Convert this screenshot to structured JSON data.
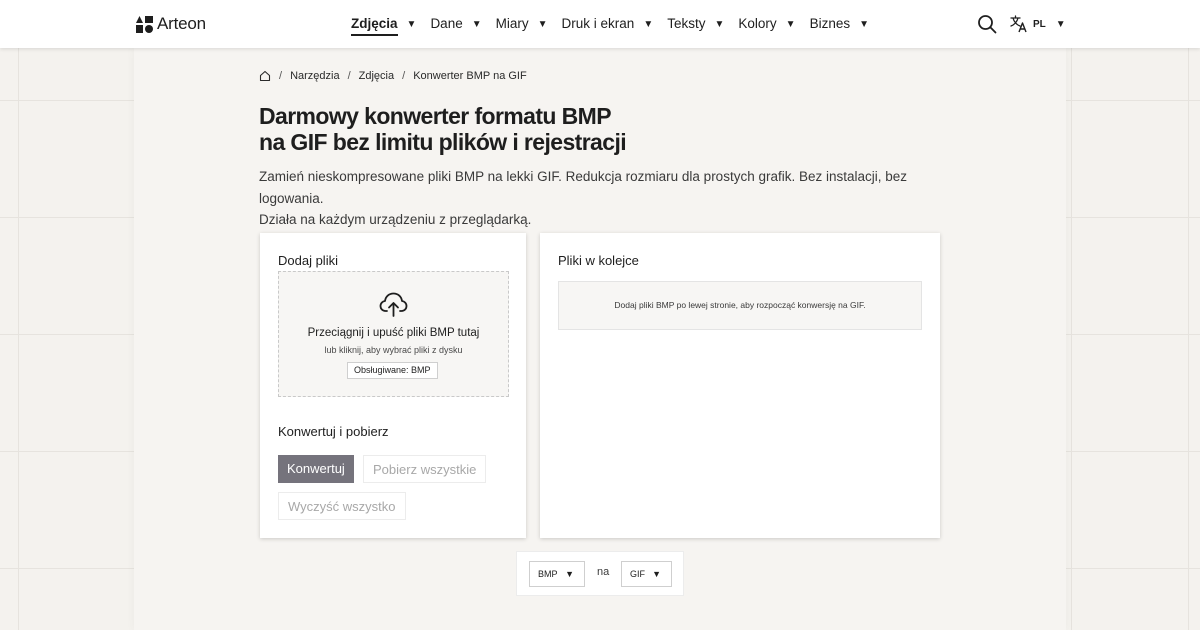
{
  "header": {
    "logo_text": "Arteon",
    "nav": [
      {
        "label": "Zdjęcia",
        "caret": "▼"
      },
      {
        "label": "Dane",
        "caret": "▼"
      },
      {
        "label": "Miary",
        "caret": "▼"
      },
      {
        "label": "Druk i ekran",
        "caret": "▼"
      },
      {
        "label": "Teksty",
        "caret": "▼"
      },
      {
        "label": "Kolory",
        "caret": "▼"
      },
      {
        "label": "Biznes",
        "caret": "▼"
      }
    ],
    "active_nav": "Zdjęcia",
    "search_icon": "search-icon",
    "language": {
      "icon": "translate-icon",
      "code": "PL",
      "caret": "▼"
    }
  },
  "breadcrumb": {
    "home_icon": "home-icon",
    "items": [
      "Narzędzia",
      "Zdjęcia",
      "Konwerter BMP na GIF"
    ],
    "separator": "/"
  },
  "page": {
    "title_line1": "Darmowy konwerter formatu BMP",
    "title_line2": "na GIF bez limitu plików i rejestracji",
    "subtitle_line1": "Zamień nieskompresowane pliki BMP na lekki GIF. Redukcja rozmiaru dla prostych grafik. Bez instalacji, bez logowania.",
    "subtitle_line2": "Działa na każdym urządzeniu z przeglądarką."
  },
  "upload": {
    "heading": "Dodaj pliki",
    "icon": "cloud-upload-icon",
    "drop_main": "Przeciągnij i upuść pliki BMP tutaj",
    "drop_sub": "lub kliknij, aby wybrać pliki z dysku",
    "supported": "Obsługiwane: BMP"
  },
  "actions": {
    "heading": "Konwertuj i pobierz",
    "convert": "Konwertuj",
    "download_all": "Pobierz wszystkie",
    "clear_all": "Wyczyść wszystko"
  },
  "queue": {
    "heading": "Pliki w kolejce",
    "empty": "Dodaj pliki BMP po lewej stronie, aby rozpocząć konwersję na GIF."
  },
  "format": {
    "from": "BMP",
    "connector": "na",
    "to": "GIF",
    "caret": "▼"
  },
  "colors": {
    "primary_button": "#75737c",
    "background": "#f4f2ee",
    "text": "#1e1e1e"
  }
}
